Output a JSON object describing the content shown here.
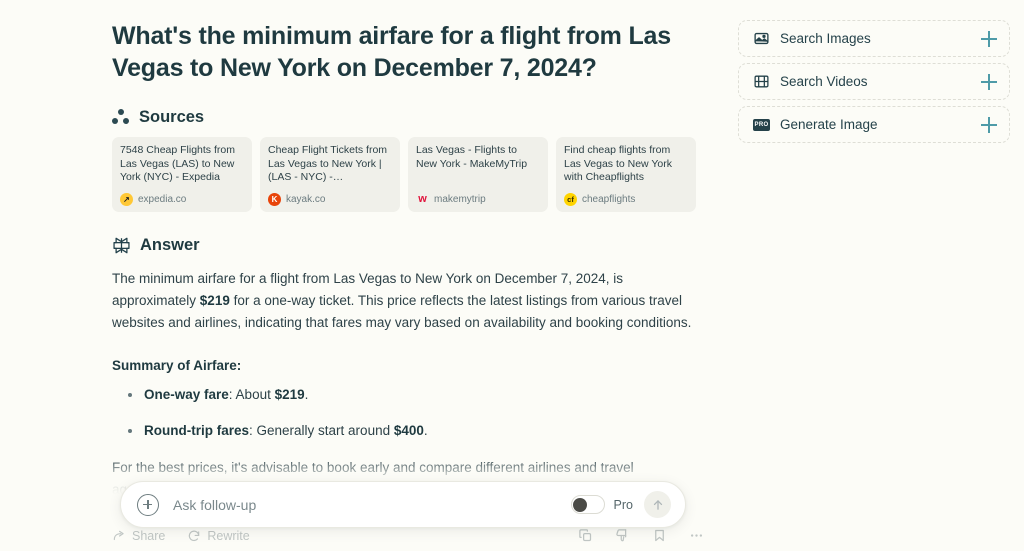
{
  "query": {
    "title": "What's the minimum airfare for a flight from Las Vegas to New York on December 7, 2024?"
  },
  "sources": {
    "heading": "Sources",
    "icon": "sources-dots-icon",
    "cards": [
      {
        "title": "7548 Cheap Flights from Las Vegas (LAS) to New York (NYC) - Expedia",
        "domain": "expedia.co",
        "favicon_glyph": "↗",
        "favicon_class": "fav-expedia"
      },
      {
        "title": "Cheap Flight Tickets from Las Vegas to New York | (LAS - NYC) -…",
        "domain": "kayak.co",
        "favicon_glyph": "K",
        "favicon_class": "fav-kayak"
      },
      {
        "title": "Las Vegas - Flights to New York - MakeMyTrip",
        "domain": "makemytrip",
        "favicon_glyph": "ᴡ",
        "favicon_class": "fav-mmt"
      },
      {
        "title": "Find cheap flights from Las Vegas to New York with Cheapflights",
        "domain": "cheapflights",
        "favicon_glyph": "cf",
        "favicon_class": "fav-cf"
      }
    ]
  },
  "answer": {
    "heading": "Answer",
    "icon": "perplexity-logo-icon",
    "paragraph_1a": "The minimum airfare for a flight from Las Vegas to New York on December 7, 2024, is approximately ",
    "paragraph_1_price": "$219",
    "paragraph_1b": " for a one-way ticket. This price reflects the latest listings from various travel websites and airlines, indicating that fares may vary based on availability and booking conditions.",
    "summary_heading": "Summary of Airfare:",
    "bullets": [
      {
        "label": "One-way fare",
        "text": ": About ",
        "value": "$219",
        "suffix": "."
      },
      {
        "label": "Round-trip fares",
        "text": ": Generally start around ",
        "value": "$400",
        "suffix": "."
      }
    ],
    "tail": "For the best prices, it's advisable to book early and compare different airlines and travel agencies."
  },
  "action_bar": {
    "share_label": "Share",
    "rewrite_label": "Rewrite",
    "icons": [
      "copy-icon",
      "thumbs-down-icon",
      "bookmark-icon",
      "more-options-icon"
    ]
  },
  "composer": {
    "add_icon": "plus-circle-icon",
    "placeholder": "Ask follow-up",
    "value": "",
    "pro_label": "Pro",
    "pro_enabled": false,
    "submit_icon": "arrow-up-icon"
  },
  "rail": {
    "items": [
      {
        "label": "Search Images",
        "icon": "image-icon",
        "action": "add"
      },
      {
        "label": "Search Videos",
        "icon": "video-icon",
        "action": "add"
      },
      {
        "label": "Generate Image",
        "icon": "pro-badge-icon",
        "action": "add",
        "badge": "PRO"
      }
    ]
  },
  "colors": {
    "page_bg": "#FCFCF7",
    "card_bg": "#F0F0EA",
    "text_dark": "#1F3A40",
    "text_body": "#2E4248",
    "accent_teal": "#4E9BA8"
  }
}
